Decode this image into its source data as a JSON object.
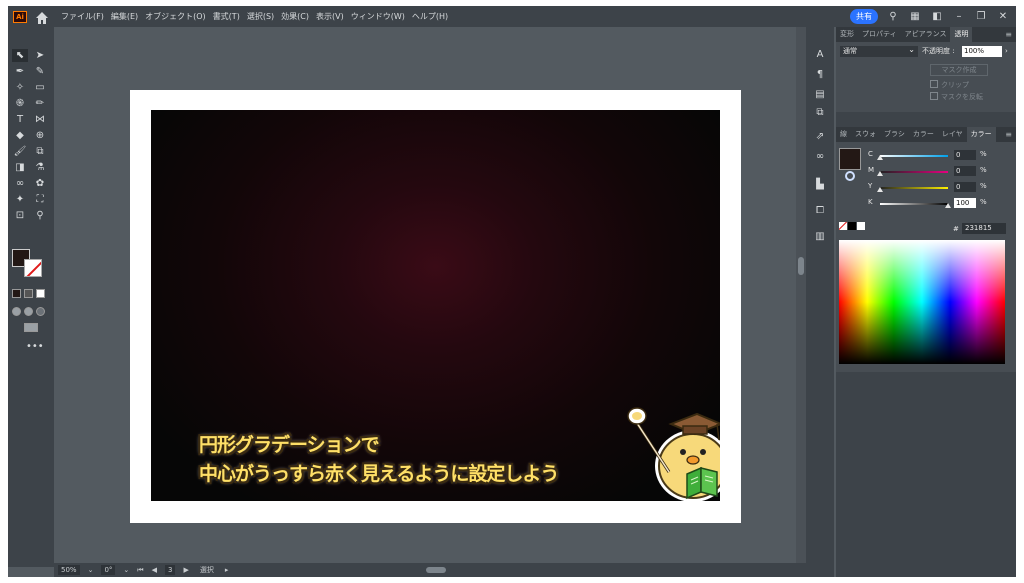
{
  "menubar": {
    "logo": "Ai",
    "items": [
      "ファイル(F)",
      "編集(E)",
      "オブジェクト(O)",
      "書式(T)",
      "選択(S)",
      "効果(C)",
      "表示(V)",
      "ウィンドウ(W)",
      "ヘルプ(H)"
    ],
    "share_label": "共有"
  },
  "artwork": {
    "caption_line1": "円形グラデーションで",
    "caption_line2": "中心がうっすら赤く見えるように設定しよう"
  },
  "statusbar": {
    "zoom": "50%",
    "rotation": "0°",
    "artboard_number": "3",
    "tool": "選択"
  },
  "transparency_panel": {
    "tabs": [
      "変形",
      "プロパティ",
      "アピアランス",
      "透明"
    ],
    "blend_mode": "通常",
    "opacity_label": "不透明度 :",
    "opacity_value": "100%",
    "make_mask": "マスク作成",
    "clip": "クリップ",
    "invert_mask": "マスクを反転"
  },
  "color_panel": {
    "tabs": [
      "線",
      "スウォ",
      "ブラシ",
      "カラー",
      "レイヤ",
      "カラー"
    ],
    "sliders": [
      {
        "label": "C",
        "value": "0",
        "unit": "%"
      },
      {
        "label": "M",
        "value": "0",
        "unit": "%"
      },
      {
        "label": "Y",
        "value": "0",
        "unit": "%"
      },
      {
        "label": "K",
        "value": "100",
        "unit": "%"
      }
    ],
    "hex_label": "#",
    "hex_value": "231815"
  },
  "colors": {
    "fill": "#231815",
    "accent": "#2b73ff",
    "ui_dark": "#3d4349"
  }
}
